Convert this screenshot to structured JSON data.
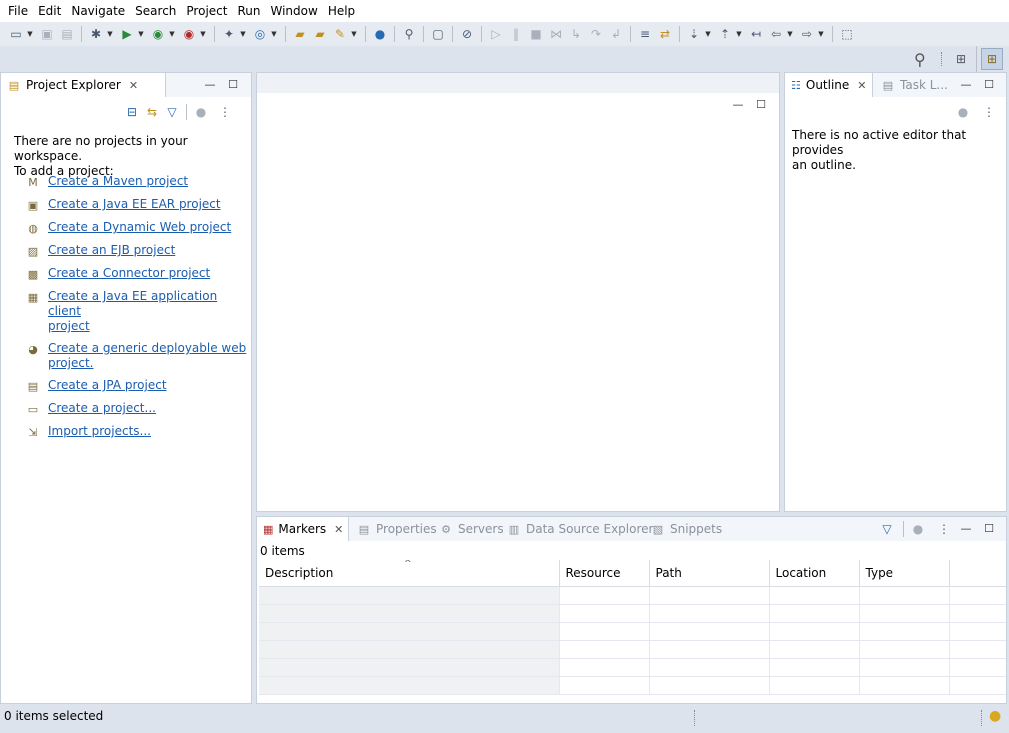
{
  "menu": [
    "File",
    "Edit",
    "Navigate",
    "Search",
    "Project",
    "Run",
    "Window",
    "Help"
  ],
  "project_explorer": {
    "title": "Project Explorer",
    "empty_line1": "There are no projects in your workspace.",
    "empty_line2": "To add a project:",
    "links": [
      {
        "label": "Create a Maven project",
        "icon": "maven-icon"
      },
      {
        "label": "Create a Java EE EAR project",
        "icon": "ear-project-icon"
      },
      {
        "label": "Create a Dynamic Web project",
        "icon": "web-project-icon"
      },
      {
        "label": "Create an EJB project",
        "icon": "ejb-project-icon"
      },
      {
        "label": "Create a Connector project",
        "icon": "connector-project-icon"
      },
      {
        "label_line1": "Create a Java EE application client",
        "label_line2": "project",
        "icon": "app-client-icon"
      },
      {
        "label_line1": "Create a generic deployable web",
        "label_line2": "project.",
        "icon": "deployable-web-icon"
      },
      {
        "label": "Create a JPA project",
        "icon": "jpa-project-icon"
      },
      {
        "label": "Create a project...",
        "icon": "new-project-icon"
      },
      {
        "label": "Import projects...",
        "icon": "import-icon"
      }
    ]
  },
  "outline": {
    "title": "Outline",
    "task_tab": "Task L...",
    "message_line1": "There is no active editor that provides",
    "message_line2": "an outline."
  },
  "bottom": {
    "tabs": [
      "Markers",
      "Properties",
      "Servers",
      "Data Source Explorer",
      "Snippets"
    ],
    "count": "0 items",
    "columns": [
      "Description",
      "Resource",
      "Path",
      "Location",
      "Type"
    ]
  },
  "status": {
    "text": "0 items selected"
  },
  "colors": {
    "link": "#1a5db0",
    "background": "#dde3ec",
    "panel": "#ffffff"
  }
}
